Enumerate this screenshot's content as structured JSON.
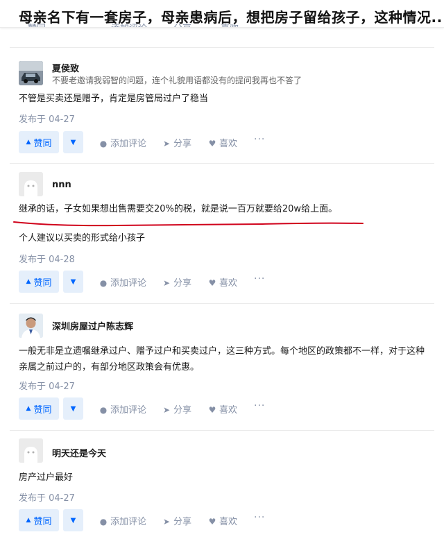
{
  "question": {
    "title": "母亲名下有一套房子，母亲患病后，想把房子留给孩子，这种情况...",
    "prev_actions": {
      "vote": "赞同",
      "comment": "添加评论",
      "share": "分享",
      "like": "喜欢"
    }
  },
  "answers": [
    {
      "author": "夏侯致",
      "headline": "不要老邀请我弱智的问题，连个礼貌用语都没有的提问我再也不答了",
      "paragraphs": [
        "不管是买卖还是赠予，肯定是房管局过户了稳当"
      ],
      "date": "发布于 04-27",
      "actions": {
        "vote": "赞同",
        "comment": "添加评论",
        "share": "分享",
        "like": "喜欢",
        "more": "···"
      }
    },
    {
      "author": "nnn",
      "headline": "",
      "paragraphs": [
        "继承的话，子女如果想出售需要交20%的税，就是说一百万就要给20w给上面。",
        "个人建议以买卖的形式给小孩子"
      ],
      "date": "发布于 04-28",
      "actions": {
        "vote": "赞同",
        "comment": "添加评论",
        "share": "分享",
        "like": "喜欢",
        "more": "···"
      }
    },
    {
      "author": "深圳房屋过户陈志辉",
      "headline": "",
      "paragraphs": [
        "一般无非是立遗嘱继承过户、赠予过户和买卖过户，这三种方式。每个地区的政策都不一样，对于这种亲属之前过户的，有部分地区政策会有优惠。"
      ],
      "date": "发布于 04-27",
      "actions": {
        "vote": "赞同",
        "comment": "添加评论",
        "share": "分享",
        "like": "喜欢",
        "more": "···"
      }
    },
    {
      "author": "明天还是今天",
      "headline": "",
      "paragraphs": [
        "房产过户最好"
      ],
      "date": "发布于 04-27",
      "actions": {
        "vote": "赞同",
        "comment": "添加评论",
        "share": "分享",
        "like": "喜欢",
        "more": "···"
      }
    }
  ],
  "colors": {
    "accent": "#0066ff",
    "vote_bg": "#e5effb",
    "meta": "#8590a6",
    "annotation": "#d0021b"
  }
}
